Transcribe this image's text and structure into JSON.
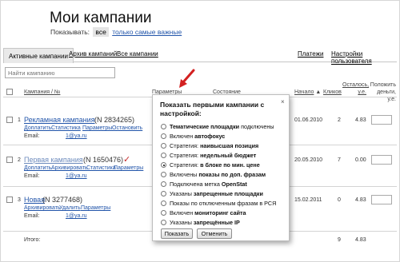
{
  "page": {
    "title": "Мои кампании",
    "show_label": "Показывать:",
    "show_all": "все",
    "show_important": "только самые важные"
  },
  "tabs": [
    {
      "label": "Активные кампании",
      "active": true
    },
    {
      "label": "Архив кампаний"
    },
    {
      "label": "Все кампании"
    },
    {
      "label": "Платежи"
    },
    {
      "label": "Настройки пользователя"
    }
  ],
  "search": {
    "placeholder": "Найти кампанию"
  },
  "table": {
    "headers": {
      "campaign": "Кампания",
      "number": "№",
      "params": "Параметры",
      "status": "Состояние",
      "start": "Начало",
      "sort_arrow": "▲",
      "clicks": "Кликов",
      "rest_line1": "Осталось,",
      "rest_line2": "у.е.",
      "put_line1": "Положить",
      "put_line2": "деньги, у.е."
    },
    "rows": [
      {
        "num": "1",
        "name": "Рекламная кампания",
        "id": "(N 2834265)",
        "actions": [
          "Доплатить",
          "Статистика",
          "Параметры",
          "Остановить"
        ],
        "email_label": "Email:",
        "email": "1@ya.ru",
        "start": "01.06.2010",
        "clicks": "2",
        "rest": "4.83"
      },
      {
        "num": "2",
        "name": "Первая кампания",
        "id": "(N 1650476)",
        "check": "✓",
        "actions": [
          "Доплатить",
          "Архивировать",
          "Статистика",
          "Параметры"
        ],
        "email_label": "Email:",
        "email": "1@ya.ru",
        "start": "20.05.2010",
        "clicks": "7",
        "rest": "0.00"
      },
      {
        "num": "3",
        "name": "Новая",
        "id": "(N 3277468)",
        "actions": [
          "Архивировать",
          "Удалить",
          "Параметры"
        ],
        "email_label": "Email:",
        "email": "1@ya.ru",
        "start": "15.02.2011",
        "clicks": "0",
        "rest": "4.83"
      }
    ],
    "total": {
      "label": "Итого:",
      "clicks": "9",
      "rest": "4.83"
    }
  },
  "popup": {
    "title": "Показать первыми кампании с настройкой:",
    "close": "×",
    "options": [
      {
        "pre": "",
        "bold": "Тематические площадки",
        "post": " подключены",
        "selected": false
      },
      {
        "pre": "Включен ",
        "bold": "автофокус",
        "post": "",
        "selected": false
      },
      {
        "pre": "Стратегия: ",
        "bold": "наивысшая позиция",
        "post": "",
        "selected": false
      },
      {
        "pre": "Стратегия: ",
        "bold": "недельный бюджет",
        "post": "",
        "selected": false
      },
      {
        "pre": "Стратегия: ",
        "bold": "в блоке по мин. цене",
        "post": "",
        "selected": true
      },
      {
        "pre": "Включены ",
        "bold": "показы по доп. фразам",
        "post": "",
        "selected": false
      },
      {
        "pre": "Подключена метка ",
        "bold": "OpenStat",
        "post": "",
        "selected": false
      },
      {
        "pre": "Указаны ",
        "bold": "запрещенные площадки",
        "post": "",
        "selected": false
      },
      {
        "pre": "Показы по отключенным фразам в РСЯ",
        "bold": "",
        "post": "",
        "selected": false
      },
      {
        "pre": "Включен ",
        "bold": "мониторинг сайта",
        "post": "",
        "selected": false
      },
      {
        "pre": "Указаны ",
        "bold": "запрещённые IP",
        "post": "",
        "selected": false
      }
    ],
    "show_button": "Показать",
    "cancel_button": "Отменить"
  },
  "colors": {
    "link": "#2255aa",
    "arrow": "#d32020",
    "check": "#c62828"
  }
}
